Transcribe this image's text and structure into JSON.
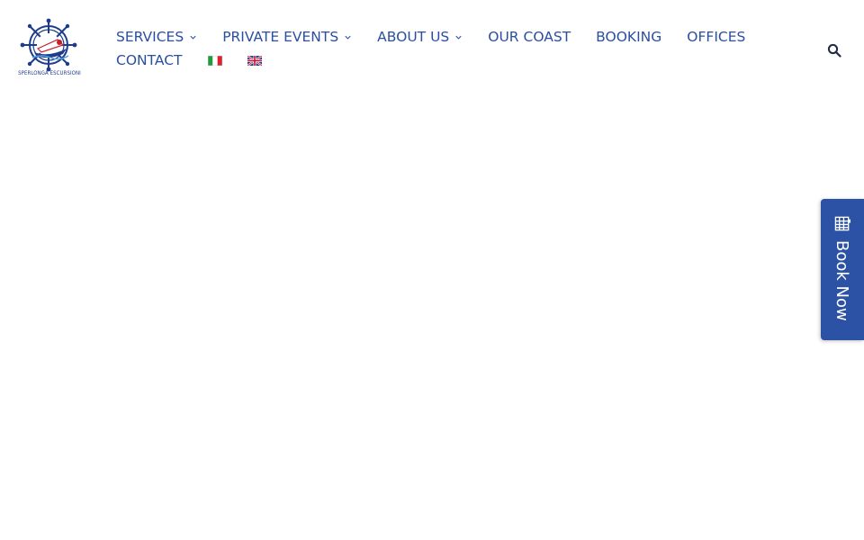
{
  "brand": {
    "logo_text": "SPERLONGA ESCURSIONI",
    "logo_icon": "ship-wheel-boat-logo"
  },
  "nav": {
    "items": [
      {
        "label": "SERVICES",
        "has_dropdown": true
      },
      {
        "label": "PRIVATE EVENTS",
        "has_dropdown": true
      },
      {
        "label": "ABOUT US",
        "has_dropdown": true
      },
      {
        "label": "OUR COAST",
        "has_dropdown": false
      },
      {
        "label": "BOOKING",
        "has_dropdown": false
      },
      {
        "label": "OFFICES",
        "has_dropdown": false
      },
      {
        "label": "CONTACT",
        "has_dropdown": false
      }
    ],
    "languages": [
      "italian-flag-icon",
      "english-flag-icon"
    ],
    "search_icon": "search-icon"
  },
  "book_now": {
    "label": "Book Now",
    "icon": "calendar-icon"
  },
  "colors": {
    "nav_text": "#2b4fa0",
    "book_now_bg": "#2c52a6",
    "background": "#ffffff"
  }
}
